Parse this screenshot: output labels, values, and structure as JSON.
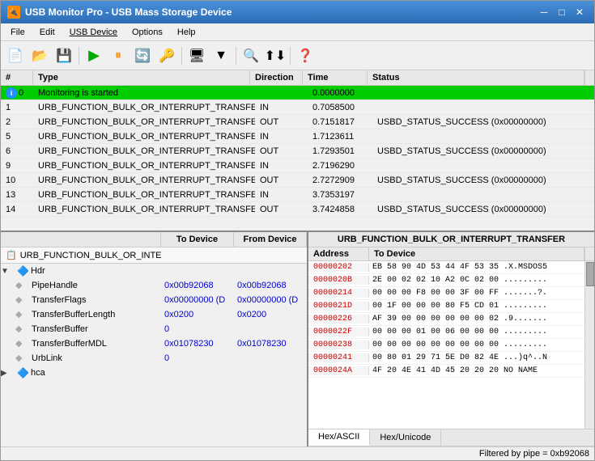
{
  "window": {
    "title": "USB Monitor Pro - USB Mass Storage Device",
    "icon": "🔌"
  },
  "menu": {
    "items": [
      "File",
      "Edit",
      "USB Device",
      "Options",
      "Help"
    ]
  },
  "toolbar": {
    "buttons": [
      "new",
      "open-dropdown",
      "save-dropdown",
      "play",
      "pause",
      "refresh",
      "key",
      "device",
      "filter-dropdown",
      "filter",
      "search",
      "transfer",
      "help"
    ]
  },
  "table": {
    "headers": [
      "#",
      "Type",
      "Direction",
      "Time",
      "Status"
    ],
    "rows": [
      {
        "num": "0",
        "type": "Monitoring is started",
        "direction": "",
        "time": "0.0000000",
        "status": "",
        "special": "monitoring",
        "has_info": true
      },
      {
        "num": "1",
        "type": "URB_FUNCTION_BULK_OR_INTERRUPT_TRANSFER",
        "direction": "IN",
        "time": "0.7058500",
        "status": "",
        "special": ""
      },
      {
        "num": "2",
        "type": "URB_FUNCTION_BULK_OR_INTERRUPT_TRANSFER",
        "direction": "OUT",
        "time": "0.7151817",
        "status": "USBD_STATUS_SUCCESS (0x00000000)",
        "special": ""
      },
      {
        "num": "5",
        "type": "URB_FUNCTION_BULK_OR_INTERRUPT_TRANSFER",
        "direction": "IN",
        "time": "1.7123611",
        "status": "",
        "special": ""
      },
      {
        "num": "6",
        "type": "URB_FUNCTION_BULK_OR_INTERRUPT_TRANSFER",
        "direction": "OUT",
        "time": "1.7293501",
        "status": "USBD_STATUS_SUCCESS (0x00000000)",
        "special": ""
      },
      {
        "num": "9",
        "type": "URB_FUNCTION_BULK_OR_INTERRUPT_TRANSFER",
        "direction": "IN",
        "time": "2.7196290",
        "status": "",
        "special": ""
      },
      {
        "num": "10",
        "type": "URB_FUNCTION_BULK_OR_INTERRUPT_TRANSFER",
        "direction": "OUT",
        "time": "2.7272909",
        "status": "USBD_STATUS_SUCCESS (0x00000000)",
        "special": ""
      },
      {
        "num": "13",
        "type": "URB_FUNCTION_BULK_OR_INTERRUPT_TRANSFER",
        "direction": "IN",
        "time": "3.7353197",
        "status": "",
        "special": ""
      },
      {
        "num": "14",
        "type": "URB_FUNCTION_BULK_OR_INTERRUPT_TRANSFER",
        "direction": "OUT",
        "time": "3.7424858",
        "status": "USBD_STATUS_SUCCESS (0x00000000)",
        "special": ""
      }
    ]
  },
  "left_panel": {
    "col1": "",
    "col2": "To Device",
    "col3": "From Device",
    "title": "URB_FUNCTION_BULK_OR_INTE",
    "rows": [
      {
        "indent": 1,
        "expand": true,
        "icon": "usb",
        "name": "Hdr",
        "val1": "",
        "val2": ""
      },
      {
        "indent": 2,
        "name": "PipeHandle",
        "val1": "0x00b92068",
        "val2": "0x00b92068"
      },
      {
        "indent": 2,
        "name": "TransferFlags",
        "val1": "0x00000000 (D",
        "val2": "0x00000000 (D"
      },
      {
        "indent": 2,
        "name": "TransferBufferLength",
        "val1": "0x0200",
        "val2": "0x0200"
      },
      {
        "indent": 2,
        "name": "TransferBuffer",
        "val1": "0",
        "val2": ""
      },
      {
        "indent": 2,
        "name": "TransferBufferMDL",
        "val1": "0x01078230",
        "val2": "0x01078230"
      },
      {
        "indent": 2,
        "name": "UrbLink",
        "val1": "0",
        "val2": ""
      },
      {
        "indent": 1,
        "expand": true,
        "icon": "usb",
        "name": "hca",
        "val1": "",
        "val2": ""
      }
    ]
  },
  "right_panel": {
    "title": "URB_FUNCTION_BULK_OR_INTERRUPT_TRANSFER",
    "col1": "Address",
    "col2": "To Device",
    "tabs": [
      "Hex/ASCII",
      "Hex/Unicode"
    ],
    "active_tab": "Hex/ASCII",
    "hex_rows": [
      {
        "addr": "00000202",
        "data": "EB 58 90 4D 53 44 4F 53 35 .X.MSDOS5"
      },
      {
        "addr": "0000020B",
        "data": "2E 00 02 02 10 A2 0C 02 00 ........."
      },
      {
        "addr": "00000214",
        "data": "00 00 00 F8 00 00 3F 00 FF .......?."
      },
      {
        "addr": "0000021D",
        "data": "00 1F 00 00 00 80 F5 CD 01 ........."
      },
      {
        "addr": "00000226",
        "data": "AF 39 00 00 00 00 00 00 02 .9......."
      },
      {
        "addr": "0000022F",
        "data": "00 00 00 01 00 06 00 00 00 ........."
      },
      {
        "addr": "00000238",
        "data": "00 00 00 00 00 00 00 00 00 ........."
      },
      {
        "addr": "00000241",
        "data": "00 80 01 29 71 5E D0 82 4E ...)q^..N"
      },
      {
        "addr": "0000024A",
        "data": "4F 20 4E 41 4D 45 20 20 20 NO NAME  "
      }
    ]
  },
  "status_bar": {
    "text": "Filtered by pipe = 0xb92068"
  },
  "colors": {
    "accent_blue": "#1e90ff",
    "monitoring_green": "#00cc00",
    "selected_blue": "#006699"
  }
}
